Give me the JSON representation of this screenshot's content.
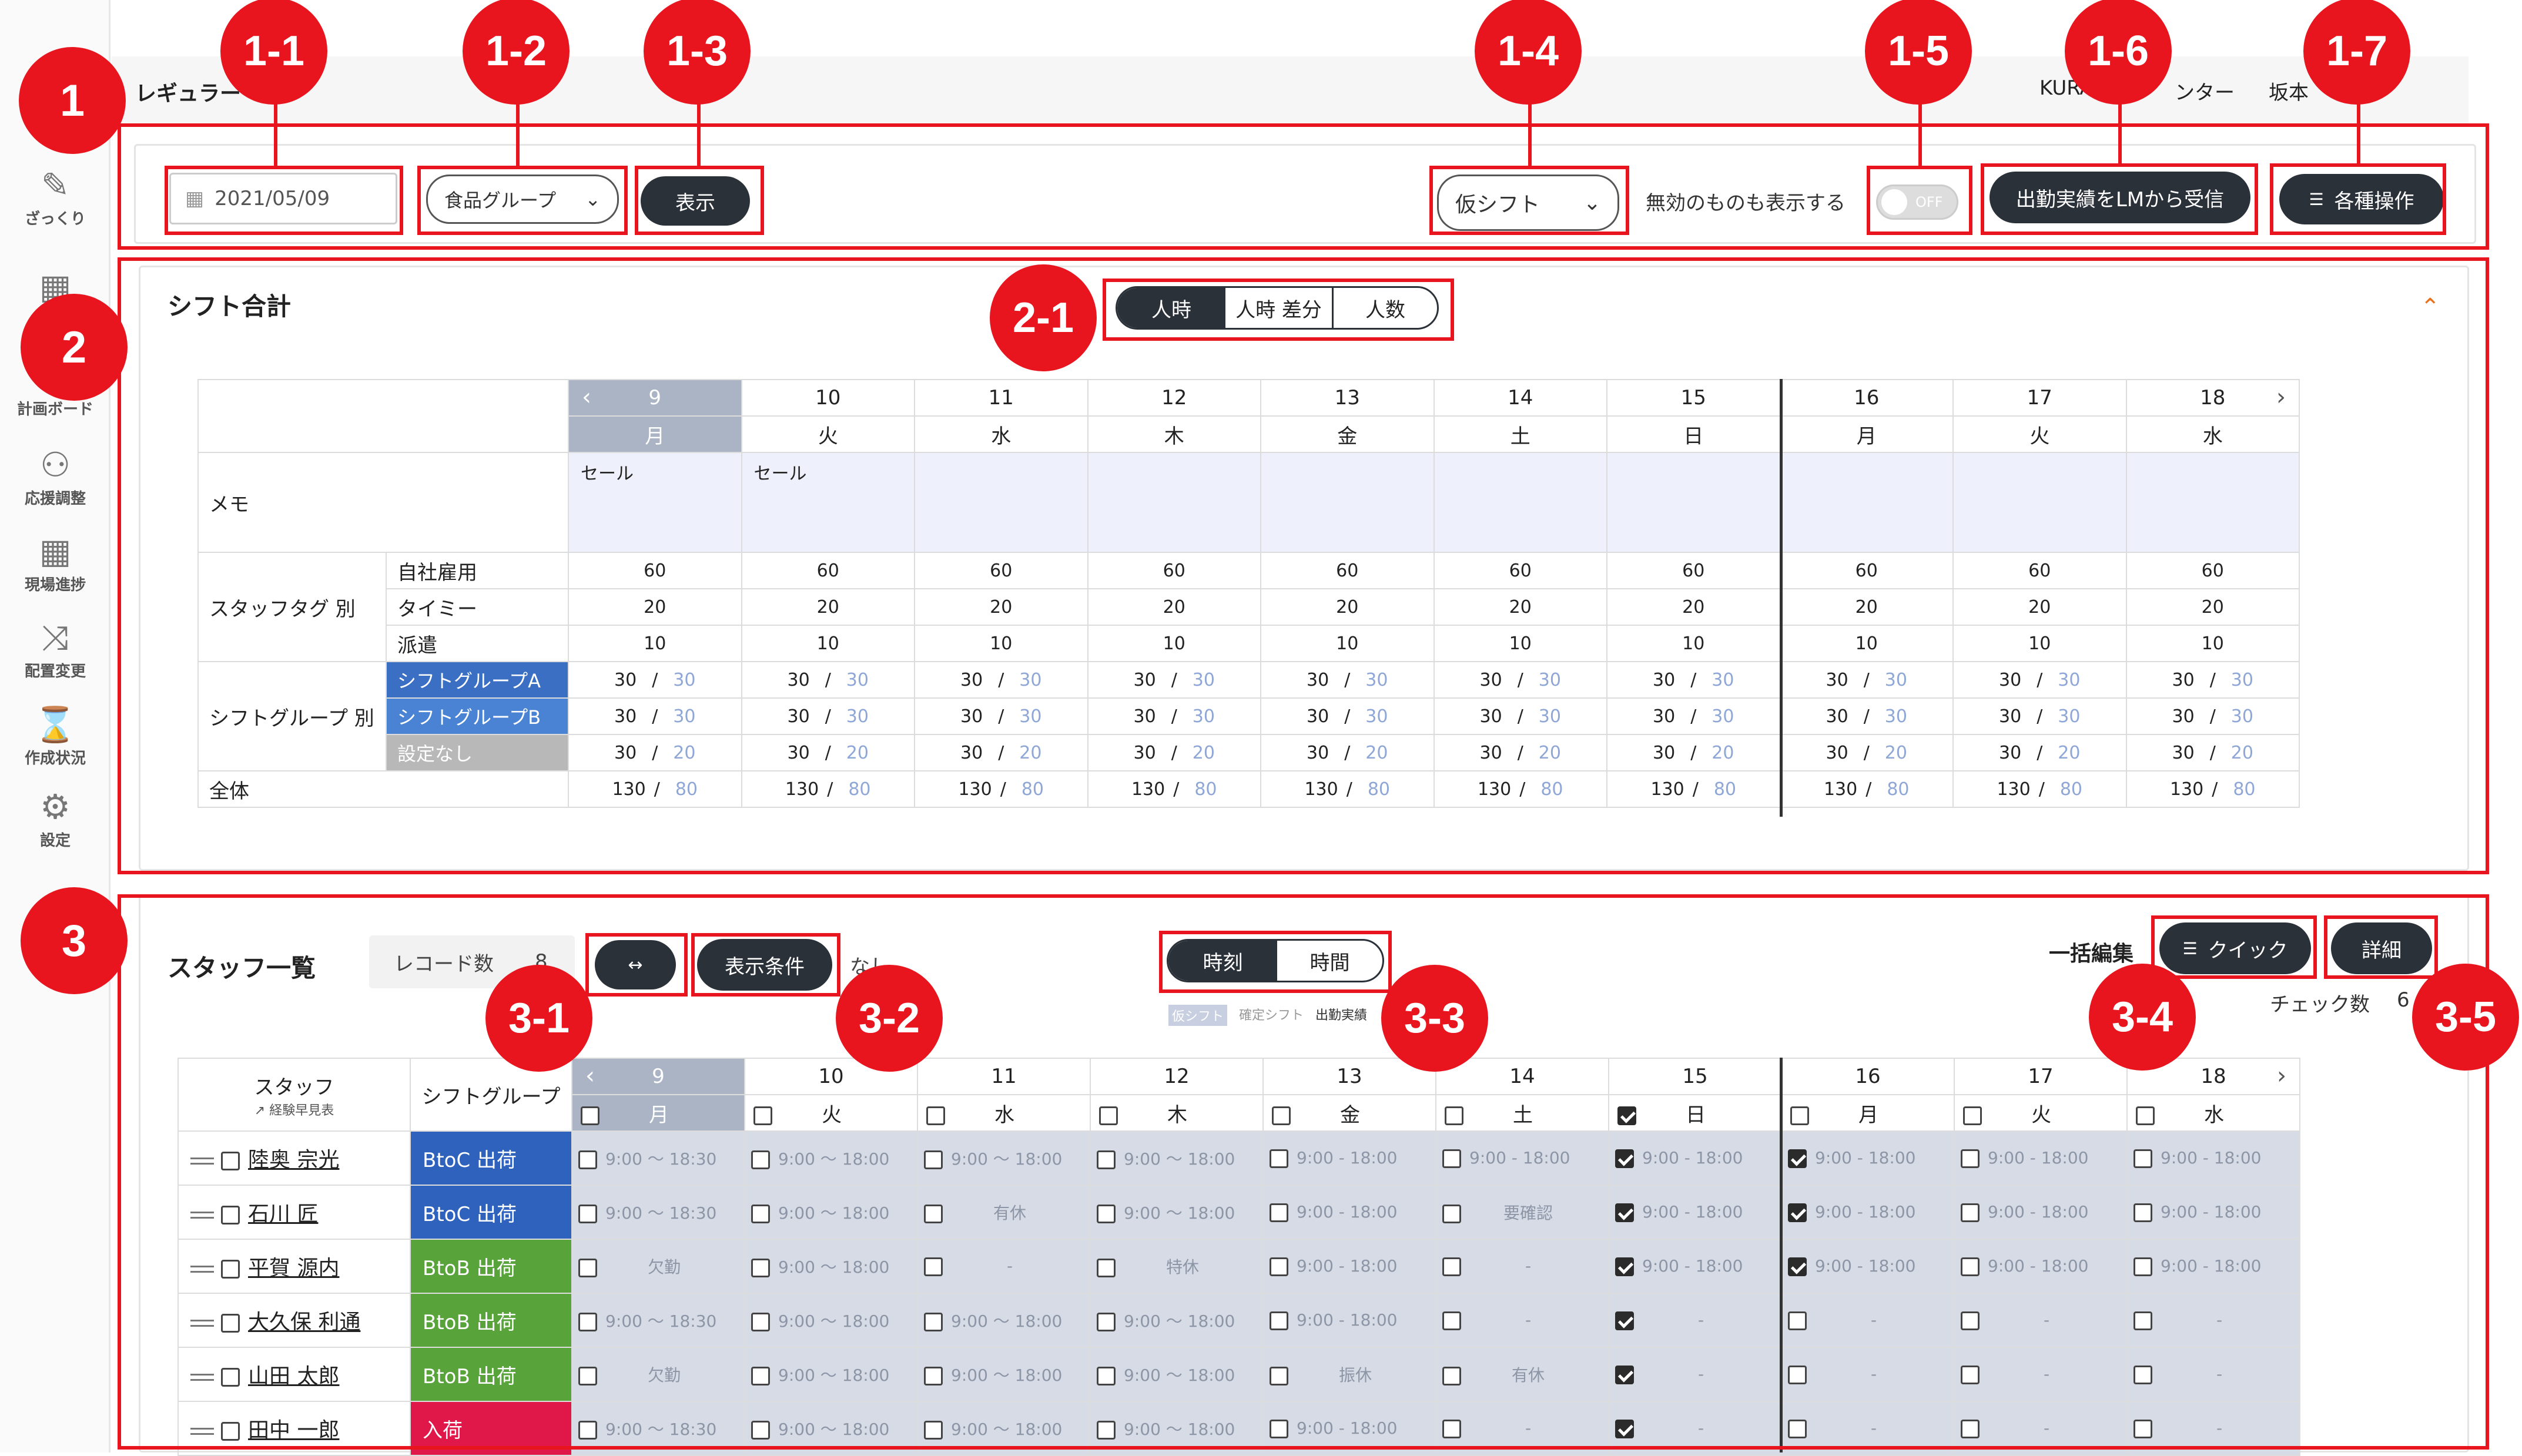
{
  "header": {
    "title_partial": "レギュラー",
    "center_name_partial": "KURA",
    "center_suffix": "ンター",
    "user_partial": "坂本 "
  },
  "sidebar": {
    "items": [
      {
        "key": "zakkuri",
        "label": "ざっくり",
        "icon": "calendar-edit-icon"
      },
      {
        "key": "plan",
        "label": "計画ボード",
        "icon": "calendar-icon"
      },
      {
        "key": "support",
        "label": "応援調整",
        "icon": "people-icon"
      },
      {
        "key": "field",
        "label": "現場進捗",
        "icon": "grid-icon"
      },
      {
        "key": "assign",
        "label": "配置変更",
        "icon": "shuffle-icon"
      },
      {
        "key": "status",
        "label": "作成状況",
        "icon": "hourglass-icon"
      },
      {
        "key": "settings",
        "label": "設定",
        "icon": "gear-icon"
      }
    ]
  },
  "toolbar": {
    "date_value": "2021/05/09",
    "group_select": "食品グループ",
    "show_button": "表示",
    "shift_select": "仮シフト",
    "invalid_label": "無効のものも表示する",
    "toggle_label": "OFF",
    "receive_button": "出勤実績をLMから受信",
    "ops_button": "各種操作"
  },
  "markers": {
    "m1": "1",
    "m1_1": "1-1",
    "m1_2": "1-2",
    "m1_3": "1-3",
    "m1_4": "1-4",
    "m1_5": "1-5",
    "m1_6": "1-6",
    "m1_7": "1-7",
    "m2": "2",
    "m2_1": "2-1",
    "m3": "3",
    "m3_1": "3-1",
    "m3_2": "3-2",
    "m3_3": "3-3",
    "m3_4": "3-4",
    "m3_5": "3-5"
  },
  "shift_total": {
    "title": "シフト合計",
    "tabs": [
      "人時",
      "人時 差分",
      "人数"
    ],
    "days": [
      {
        "num": "9",
        "wd": "月"
      },
      {
        "num": "10",
        "wd": "火"
      },
      {
        "num": "11",
        "wd": "水"
      },
      {
        "num": "12",
        "wd": "木"
      },
      {
        "num": "13",
        "wd": "金"
      },
      {
        "num": "14",
        "wd": "土"
      },
      {
        "num": "15",
        "wd": "日"
      },
      {
        "num": "16",
        "wd": "月"
      },
      {
        "num": "17",
        "wd": "火"
      },
      {
        "num": "18",
        "wd": "水"
      }
    ],
    "memo_label": "メモ",
    "memos": [
      "セール",
      "セール",
      "",
      "",
      "",
      "",
      "",
      "",
      "",
      ""
    ],
    "tag_label": "スタッフタグ 別",
    "tags": [
      {
        "name": "自社雇用",
        "value": "60"
      },
      {
        "name": "タイミー",
        "value": "20"
      },
      {
        "name": "派遣",
        "value": "10"
      }
    ],
    "group_label": "シフトグループ 別",
    "groups": [
      {
        "name": "シフトグループA",
        "a": "30",
        "b": "30"
      },
      {
        "name": "シフトグループB",
        "a": "30",
        "b": "30"
      },
      {
        "name": "設定なし",
        "a": "30",
        "b": "20"
      }
    ],
    "total_label": "全体",
    "total": {
      "a": "130",
      "b": "80"
    },
    "sep": "/"
  },
  "staff_list": {
    "title": "スタッフ一覧",
    "record_label": "レコード数",
    "record_count": "8",
    "cond_button": "表示条件",
    "none_label": "なし",
    "toggle_options": [
      "時刻",
      "時間"
    ],
    "legend": [
      "仮シフト",
      "確定シフト",
      "出勤実績"
    ],
    "bulk_label": "一括編集",
    "quick_button": "クイック",
    "detail_button": "詳細",
    "check_label": "チェック数",
    "check_count": "6",
    "col_staff": "スタッフ",
    "col_staff_sub": "経験早見表",
    "col_group": "シフトグループ",
    "rows": [
      {
        "name": "陸奥 宗光",
        "group": "BtoC 出荷",
        "gtype": "btoc",
        "cells": [
          "9:00 ～ 18:30",
          "9:00 ～ 18:00",
          "9:00 ～ 18:00",
          "9:00 ～ 18:00",
          "9:00 - 18:00",
          "9:00 - 18:00",
          "9:00 - 18:00",
          "9:00 - 18:00",
          "9:00 - 18:00",
          "9:00 - 18:00"
        ],
        "checks": [
          0,
          0,
          0,
          0,
          0,
          0,
          1,
          1,
          0,
          0
        ]
      },
      {
        "name": "石川 匠",
        "group": "BtoC 出荷",
        "gtype": "btoc",
        "cells": [
          "9:00 ～ 18:30",
          "9:00 ～ 18:00",
          "有休",
          "9:00 ～ 18:00",
          "9:00 - 18:00",
          "要確認",
          "9:00 - 18:00",
          "9:00 - 18:00",
          "9:00 - 18:00",
          "9:00 - 18:00"
        ],
        "checks": [
          0,
          0,
          0,
          0,
          0,
          0,
          1,
          1,
          0,
          0
        ]
      },
      {
        "name": "平賀 源内",
        "group": "BtoB 出荷",
        "gtype": "btob",
        "cells": [
          "欠勤",
          "9:00 ～ 18:00",
          "-",
          "特休",
          "9:00 - 18:00",
          "-",
          "9:00 - 18:00",
          "9:00 - 18:00",
          "9:00 - 18:00",
          "9:00 - 18:00"
        ],
        "checks": [
          0,
          0,
          0,
          0,
          0,
          0,
          1,
          1,
          0,
          0
        ]
      },
      {
        "name": "大久保 利通",
        "group": "BtoB 出荷",
        "gtype": "btob",
        "cells": [
          "9:00 ～ 18:30",
          "9:00 ～ 18:00",
          "9:00 ～ 18:00",
          "9:00 ～ 18:00",
          "9:00 - 18:00",
          "-",
          "-",
          "-",
          "-",
          "-"
        ],
        "checks": [
          0,
          0,
          0,
          0,
          0,
          0,
          1,
          0,
          0,
          0
        ]
      },
      {
        "name": "山田 太郎",
        "group": "BtoB 出荷",
        "gtype": "btob",
        "cells": [
          "欠勤",
          "9:00 ～ 18:00",
          "9:00 ～ 18:00",
          "9:00 ～ 18:00",
          "振休",
          "有休",
          "-",
          "-",
          "-",
          "-"
        ],
        "checks": [
          0,
          0,
          0,
          0,
          0,
          0,
          1,
          0,
          0,
          0
        ]
      },
      {
        "name": "田中 一郎",
        "group": "入荷",
        "gtype": "in",
        "cells": [
          "9:00 ～ 18:30",
          "9:00 ～ 18:00",
          "9:00 ～ 18:00",
          "9:00 ～ 18:00",
          "9:00 - 18:00",
          "-",
          "-",
          "-",
          "-",
          "-"
        ],
        "checks": [
          0,
          0,
          0,
          0,
          0,
          0,
          1,
          0,
          0,
          0
        ]
      }
    ],
    "header_checks": [
      0,
      0,
      0,
      0,
      0,
      0,
      1,
      0,
      0,
      0
    ]
  },
  "colors": {
    "accent_red": "#e8151f",
    "dark_button": "#2b3139"
  }
}
